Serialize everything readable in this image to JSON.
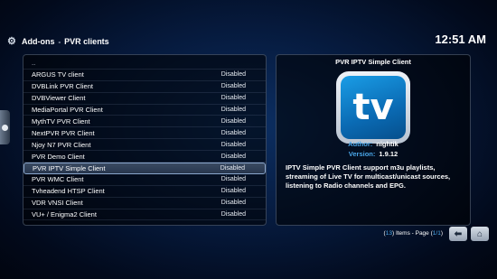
{
  "header": {
    "section": "Add-ons",
    "separator": "-",
    "page": "PVR clients",
    "time": "12:51 AM"
  },
  "list": {
    "parent": "..",
    "items": [
      {
        "name": "ARGUS TV client",
        "status": "Disabled"
      },
      {
        "name": "DVBLink PVR Client",
        "status": "Disabled"
      },
      {
        "name": "DVBViewer Client",
        "status": "Disabled"
      },
      {
        "name": "MediaPortal PVR Client",
        "status": "Disabled"
      },
      {
        "name": "MythTV PVR Client",
        "status": "Disabled"
      },
      {
        "name": "NextPVR PVR Client",
        "status": "Disabled"
      },
      {
        "name": "Njoy N7 PVR Client",
        "status": "Disabled"
      },
      {
        "name": "PVR Demo Client",
        "status": "Disabled"
      },
      {
        "name": "PVR IPTV Simple Client",
        "status": "Disabled"
      },
      {
        "name": "PVR WMC Client",
        "status": "Disabled"
      },
      {
        "name": "Tvheadend HTSP Client",
        "status": "Disabled"
      },
      {
        "name": "VDR VNSI Client",
        "status": "Disabled"
      },
      {
        "name": "VU+ / Enigma2 Client",
        "status": "Disabled"
      }
    ],
    "selected_index": 8
  },
  "detail": {
    "title": "PVR IPTV Simple Client",
    "icon_text": "TV",
    "author_label": "Author:",
    "author": "nightik",
    "version_label": "Version:",
    "version": "1.9.12",
    "description": "IPTV Simple PVR Client support m3u playlists, streaming of Live TV for multicast/unicast sources, listening to Radio channels and EPG."
  },
  "footer": {
    "count": "13",
    "items_label": "Items - Page",
    "page": "1/1"
  },
  "colors": {
    "accent": "#4aa6e8",
    "background": "#061a3d"
  },
  "icons": {
    "section": "gear-icon",
    "back": "back-arrow-icon",
    "home": "home-icon"
  }
}
